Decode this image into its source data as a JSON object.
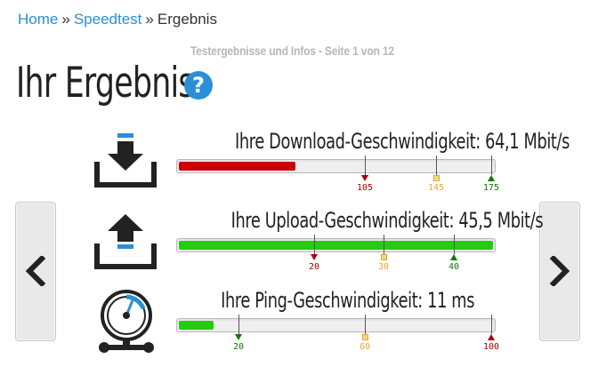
{
  "breadcrumb": {
    "home": "Home",
    "sep1": "»",
    "speedtest": "Speedtest",
    "sep2": "»",
    "current": "Ergebnis"
  },
  "subtitle": "Testergebnisse und Infos - Seite 1 von 12",
  "title": "Ihr Ergebnis",
  "help_icon": "?",
  "colors": {
    "accent": "#2a8fd6",
    "download_bar": "#cc0000",
    "good_bar": "#22cc11",
    "marker_red": "#aa0000",
    "marker_orange": "#e8a630",
    "marker_green": "#117a00"
  },
  "results": [
    {
      "icon": "download-icon",
      "label": "Ihre Download-Geschwindigkeit: 64,1 Mbit/s",
      "fill_fraction": 0.37,
      "markers": [
        {
          "label": "105",
          "color": "#aa0000",
          "kind": "arrow-down"
        },
        {
          "label": "145",
          "color": "#e8a630",
          "kind": "box"
        },
        {
          "label": "175",
          "color": "#117a00",
          "kind": "arrow-up"
        }
      ]
    },
    {
      "icon": "upload-icon",
      "label": "Ihre Upload-Geschwindigkeit: 45,5 Mbit/s",
      "fill_fraction": 1.0,
      "markers": [
        {
          "label": "20",
          "color": "#aa0000",
          "kind": "arrow-down"
        },
        {
          "label": "30",
          "color": "#e8a630",
          "kind": "box"
        },
        {
          "label": "40",
          "color": "#117a00",
          "kind": "arrow-up"
        }
      ]
    },
    {
      "icon": "speedometer-icon",
      "label": "Ihre Ping-Geschwindigkeit: 11 ms",
      "fill_fraction": 0.11,
      "markers": [
        {
          "label": "20",
          "color": "#117a00",
          "kind": "arrow-down"
        },
        {
          "label": "60",
          "color": "#e8a630",
          "kind": "box"
        },
        {
          "label": "100",
          "color": "#aa0000",
          "kind": "arrow-up"
        }
      ]
    }
  ]
}
